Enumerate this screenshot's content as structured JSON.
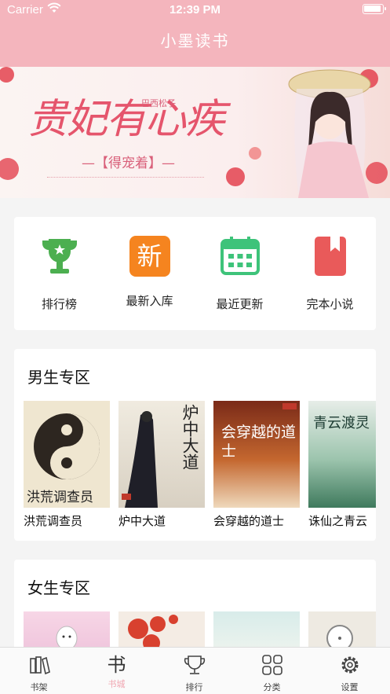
{
  "status": {
    "carrier": "Carrier",
    "time": "12:39 PM"
  },
  "nav": {
    "title": "小墨读书"
  },
  "banner": {
    "title": "贵妃有心疾",
    "subtitle": "—【得宠着】—",
    "author": "巴西松子"
  },
  "categories": [
    {
      "label": "排行榜",
      "icon": "trophy-icon",
      "color": "#4caf50"
    },
    {
      "label": "最新入库",
      "icon": "new-badge-icon",
      "icon_text": "新",
      "color": "#f5841f"
    },
    {
      "label": "最近更新",
      "icon": "calendar-icon",
      "color": "#3ec37a"
    },
    {
      "label": "完本小说",
      "icon": "bookmark-book-icon",
      "color": "#e95a5a"
    }
  ],
  "male_section": {
    "title": "男生专区",
    "books": [
      {
        "name": "洪荒调查员",
        "cover_text": "洪荒调查员"
      },
      {
        "name": "炉中大道",
        "cover_text": "炉中大道"
      },
      {
        "name": "会穿越的道士",
        "cover_text": "会穿越的道士"
      },
      {
        "name": "诛仙之青云",
        "cover_text": "青云渡灵"
      }
    ]
  },
  "female_section": {
    "title": "女生专区"
  },
  "tabs": [
    {
      "label": "书架",
      "icon": "bookshelf-icon",
      "active": false
    },
    {
      "label": "书城",
      "icon": "bookstore-icon",
      "active": true
    },
    {
      "label": "排行",
      "icon": "trophy-icon",
      "active": false
    },
    {
      "label": "分类",
      "icon": "category-grid-icon",
      "active": false
    },
    {
      "label": "设置",
      "icon": "gear-icon",
      "active": false
    }
  ],
  "colors": {
    "accent": "#f4b5bd",
    "active_tab": "#f0a6b1"
  }
}
